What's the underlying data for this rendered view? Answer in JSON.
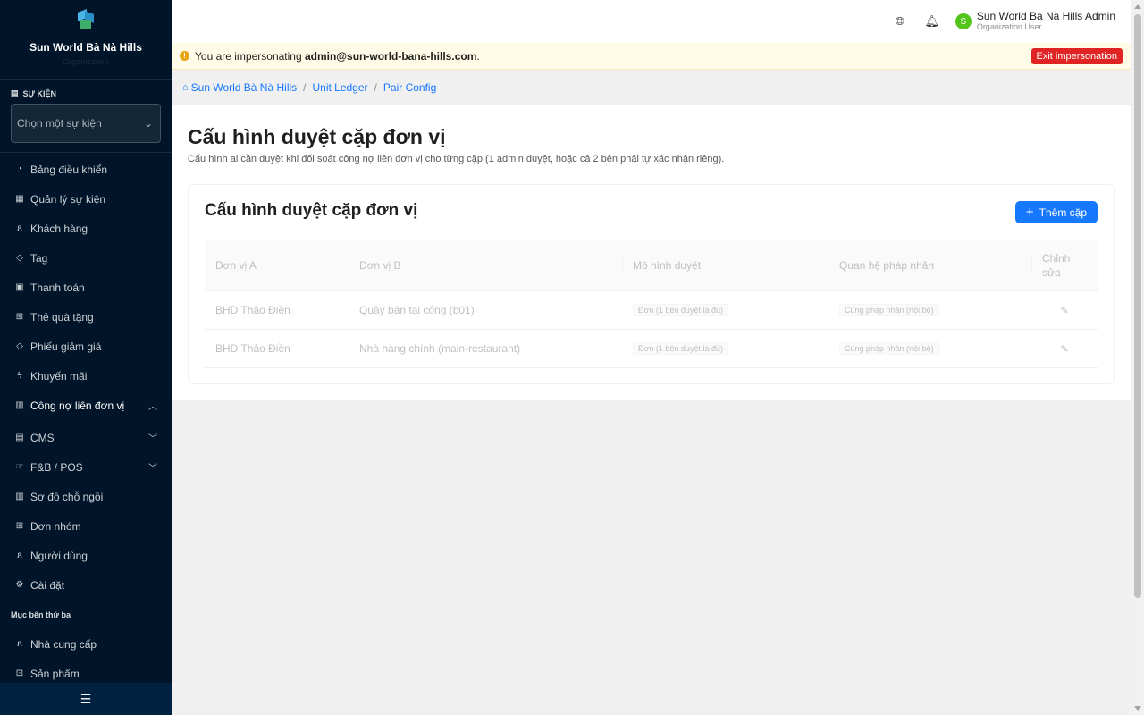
{
  "sidebar": {
    "brand_name": "Sun World Bà Nà Hills",
    "brand_sub": "Organization",
    "event_section_label": "SỰ KIỆN",
    "event_select_placeholder": "Chọn một sự kiện",
    "items": [
      {
        "label": "Bảng điều khiển",
        "icon": "dashboard-icon"
      },
      {
        "label": "Quản lý sự kiện",
        "icon": "calendar-icon"
      },
      {
        "label": "Khách hàng",
        "icon": "users-icon"
      },
      {
        "label": "Tag",
        "icon": "tag-icon"
      },
      {
        "label": "Thanh toán",
        "icon": "payment-icon"
      },
      {
        "label": "Thẻ quà tặng",
        "icon": "gift-icon"
      },
      {
        "label": "Phiếu giảm giá",
        "icon": "coupon-icon"
      },
      {
        "label": "Khuyến mãi",
        "icon": "promotion-icon"
      },
      {
        "label": "Công nợ liên đơn vị",
        "icon": "ledger-icon"
      },
      {
        "label": "CMS",
        "icon": "cms-icon"
      },
      {
        "label": "F&B / POS",
        "icon": "pos-icon"
      },
      {
        "label": "Sơ đồ chỗ ngồi",
        "icon": "seating-icon"
      },
      {
        "label": "Đơn nhóm",
        "icon": "group-order-icon"
      },
      {
        "label": "Người dùng",
        "icon": "user-icon"
      },
      {
        "label": "Cài đặt",
        "icon": "settings-icon"
      }
    ],
    "third_party_label": "Mục bên thứ ba",
    "third_party_items": [
      {
        "label": "Nhà cung cấp",
        "icon": "vendor-icon"
      },
      {
        "label": "Sản phẩm",
        "icon": "product-icon"
      }
    ]
  },
  "header": {
    "user_initial": "S",
    "user_name": "Sun World Bà Nà Hills Admin",
    "user_role": "Organization User"
  },
  "banner": {
    "prefix": "You are impersonating",
    "email": "admin@sun-world-bana-hills.com",
    "suffix": ".",
    "exit_label": "Exit impersonation"
  },
  "breadcrumb": [
    "Sun World Bà Nà Hills",
    "Unit Ledger",
    "Pair Config"
  ],
  "page": {
    "title": "Cấu hình duyệt cặp đơn vị",
    "description": "Cấu hình ai cần duyệt khi đối soát công nợ liên đơn vị cho từng cặp (1 admin duyệt, hoặc cả 2 bên phải tự xác nhận riêng)."
  },
  "card": {
    "title": "Cấu hình duyệt cặp đơn vị",
    "add_label": "Thêm cặp",
    "columns": [
      "Đơn vị A",
      "Đơn vị B",
      "Mô hình duyệt",
      "Quan hệ pháp nhân",
      "Chỉnh sửa"
    ],
    "rows": [
      {
        "unit_a": "BHD Thảo Điền",
        "unit_b": "Quầy bán tại cổng (b01)",
        "model": "Đơn (1 bên duyệt là đủ)",
        "relation": "Cùng pháp nhân (nội bộ)"
      },
      {
        "unit_a": "BHD Thảo Điền",
        "unit_b": "Nhà hàng chính (main-restaurant)",
        "model": "Đơn (1 bên duyệt là đủ)",
        "relation": "Cùng pháp nhân (nội bộ)"
      }
    ]
  },
  "colors": {
    "sidebar_bg": "#001529",
    "primary": "#1677ff",
    "danger": "#e02424",
    "avatar": "#52c41a",
    "banner_bg": "#fffbe6"
  }
}
